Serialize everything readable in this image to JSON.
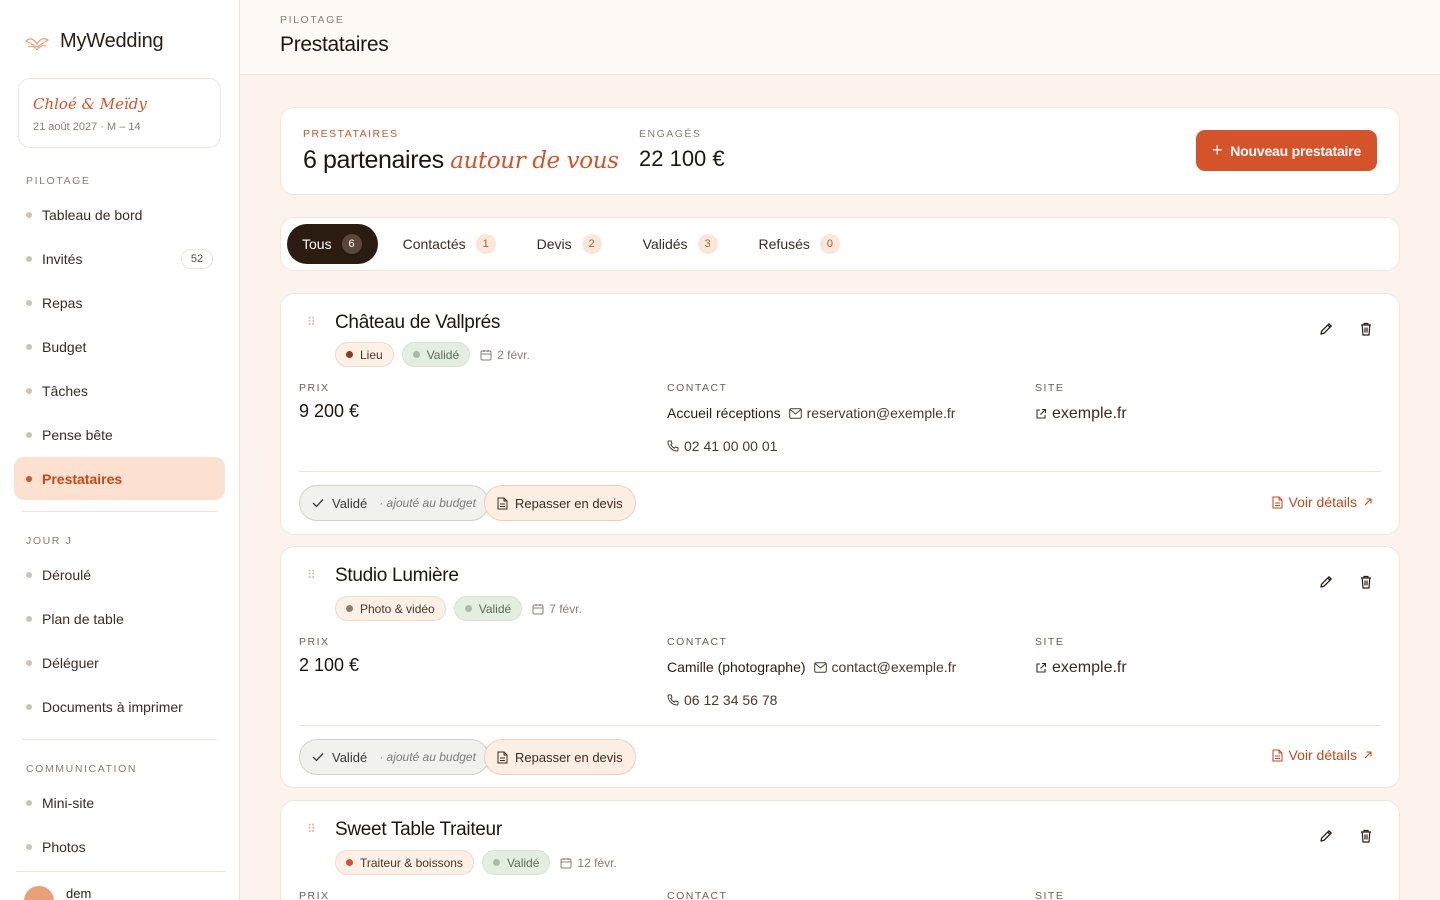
{
  "brand": {
    "name": "MyWedding"
  },
  "couple": {
    "name": "Chloé & Meïdy",
    "date": "21 août 2027 · M – 14"
  },
  "nav": {
    "section_pilotage": "PILOTAGE",
    "section_jourj": "JOUR J",
    "section_communication": "COMMUNICATION",
    "items": [
      {
        "label": "Tableau de bord"
      },
      {
        "label": "Invités",
        "badge": "52"
      },
      {
        "label": "Repas"
      },
      {
        "label": "Budget"
      },
      {
        "label": "Tâches"
      },
      {
        "label": "Pense bête"
      },
      {
        "label": "Prestataires"
      },
      {
        "label": "Déroulé"
      },
      {
        "label": "Plan de table"
      },
      {
        "label": "Déléguer"
      },
      {
        "label": "Documents à imprimer"
      },
      {
        "label": "Mini-site"
      },
      {
        "label": "Photos"
      }
    ],
    "active": "Prestataires"
  },
  "user": {
    "name": "dem"
  },
  "header": {
    "kicker": "PILOTAGE",
    "title": "Prestataires"
  },
  "summary": {
    "kicker": "PRESTATAIRES",
    "title_main": "6 partenaires ",
    "title_accent": "autour de vous",
    "engaged_label": "ENGAGÉS",
    "engaged_value": "22 100 €",
    "new_button": "Nouveau prestataire"
  },
  "tabs": [
    {
      "label": "Tous",
      "count": "6",
      "active": true
    },
    {
      "label": "Contactés",
      "count": "1"
    },
    {
      "label": "Devis",
      "count": "2"
    },
    {
      "label": "Validés",
      "count": "3"
    },
    {
      "label": "Refusés",
      "count": "0"
    }
  ],
  "labels": {
    "price": "PRIX",
    "contact": "CONTACT",
    "site": "SITE",
    "status_validated": "Validé",
    "status_note": "· ajouté au budget",
    "requote": "Repasser en devis",
    "details": "Voir détails"
  },
  "colors": {
    "accent": "#d4532a",
    "validated_bg": "#e3eee1",
    "sidebar_active_bg": "#fce0d0"
  },
  "vendors": [
    {
      "name": "Château de Vallprés",
      "category": "Lieu",
      "category_dot": "#8a3a1e",
      "status": "Validé",
      "date": "2 févr.",
      "price": "9 200 €",
      "contact_name": "Accueil réceptions",
      "email": "reservation@exemple.fr",
      "phone": "02 41 00 00 01",
      "site": "exemple.fr"
    },
    {
      "name": "Studio Lumière",
      "category": "Photo & vidéo",
      "category_dot": "#8c7d70",
      "status": "Validé",
      "date": "7 févr.",
      "price": "2 100 €",
      "contact_name": "Camille (photographe)",
      "email": "contact@exemple.fr",
      "phone": "06 12 34 56 78",
      "site": "exemple.fr"
    },
    {
      "name": "Sweet Table Traiteur",
      "category": "Traiteur & boissons",
      "category_dot": "#d4532a",
      "status": "Validé",
      "date": "12 févr.",
      "price": "",
      "contact_name": "",
      "email": "",
      "phone": "",
      "site": ""
    }
  ]
}
